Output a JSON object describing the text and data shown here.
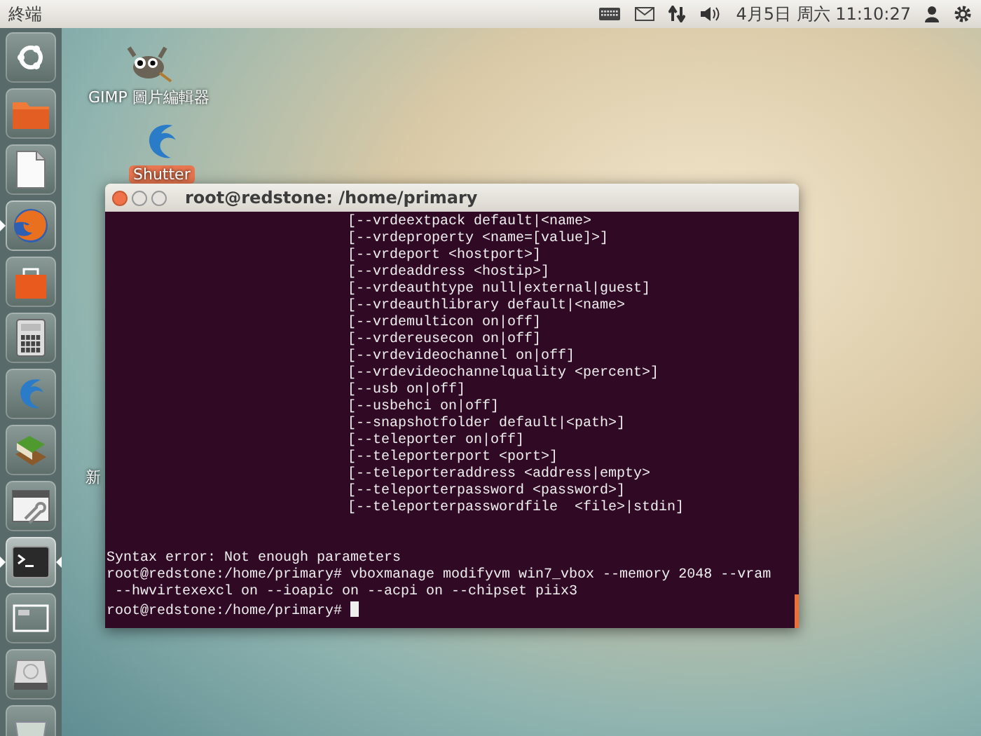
{
  "top_panel": {
    "title": "終端",
    "clock": "4月5日 周六 11:10:27"
  },
  "launcher": [
    {
      "kind": "dash",
      "running": false,
      "focused": false
    },
    {
      "kind": "files",
      "running": false,
      "focused": false
    },
    {
      "kind": "writer",
      "running": false,
      "focused": false
    },
    {
      "kind": "firefox",
      "running": true,
      "focused": false
    },
    {
      "kind": "store",
      "running": false,
      "focused": false
    },
    {
      "kind": "calculator",
      "running": false,
      "focused": false
    },
    {
      "kind": "shutter",
      "running": false,
      "focused": false
    },
    {
      "kind": "books",
      "running": false,
      "focused": false
    },
    {
      "kind": "tools",
      "running": false,
      "focused": false
    },
    {
      "kind": "terminal",
      "running": true,
      "focused": true
    },
    {
      "kind": "workspaces",
      "running": false,
      "focused": false
    },
    {
      "kind": "drive",
      "running": false,
      "focused": false
    },
    {
      "kind": "trash",
      "running": false,
      "focused": false
    }
  ],
  "desktop_icons": [
    {
      "kind": "gimp",
      "label": "GIMP 圖片編輯器",
      "selected": false
    },
    {
      "kind": "shutter",
      "label": "Shutter",
      "selected": true
    },
    {
      "kind": "file",
      "label": "新",
      "selected": false
    }
  ],
  "terminal": {
    "title": "root@redstone: /home/primary",
    "lines": [
      {
        "kind": "option",
        "text": "[--vrdeextpack default|<name>"
      },
      {
        "kind": "option",
        "text": "[--vrdeproperty <name=[value]>]"
      },
      {
        "kind": "option",
        "text": "[--vrdeport <hostport>]"
      },
      {
        "kind": "option",
        "text": "[--vrdeaddress <hostip>]"
      },
      {
        "kind": "option",
        "text": "[--vrdeauthtype null|external|guest]"
      },
      {
        "kind": "option",
        "text": "[--vrdeauthlibrary default|<name>"
      },
      {
        "kind": "option",
        "text": "[--vrdemulticon on|off]"
      },
      {
        "kind": "option",
        "text": "[--vrdereusecon on|off]"
      },
      {
        "kind": "option",
        "text": "[--vrdevideochannel on|off]"
      },
      {
        "kind": "option",
        "text": "[--vrdevideochannelquality <percent>]"
      },
      {
        "kind": "option",
        "text": "[--usb on|off]"
      },
      {
        "kind": "option",
        "text": "[--usbehci on|off]"
      },
      {
        "kind": "option",
        "text": "[--snapshotfolder default|<path>]"
      },
      {
        "kind": "option",
        "text": "[--teleporter on|off]"
      },
      {
        "kind": "option",
        "text": "[--teleporterport <port>]"
      },
      {
        "kind": "option",
        "text": "[--teleporteraddress <address|empty>"
      },
      {
        "kind": "option",
        "text": "[--teleporterpassword <password>]"
      },
      {
        "kind": "option",
        "text": "[--teleporterpasswordfile  <file>|stdin]"
      },
      {
        "kind": "output",
        "text": "Syntax error: Not enough parameters"
      },
      {
        "kind": "output",
        "text": "root@redstone:/home/primary# vboxmanage modifyvm win7_vbox --memory 2048 --vram"
      },
      {
        "kind": "output",
        "text": " --hwvirtexexcl on --ioapic on --acpi on --chipset piix3"
      },
      {
        "kind": "prompt",
        "text": "root@redstone:/home/primary#"
      }
    ]
  }
}
